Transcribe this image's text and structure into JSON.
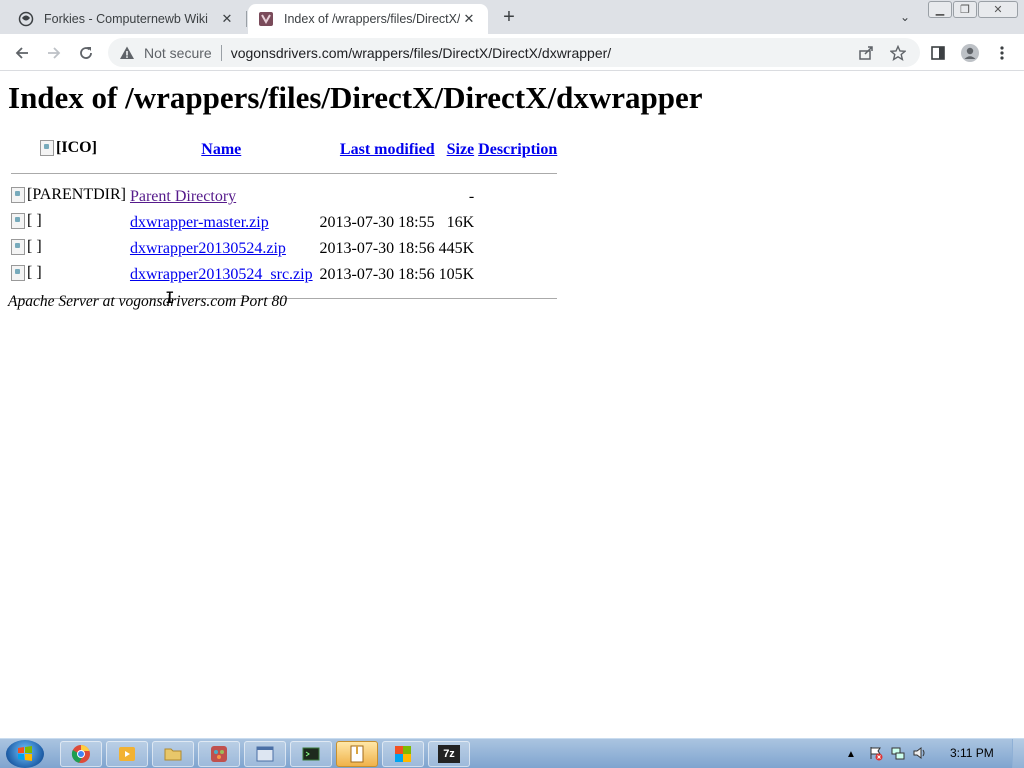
{
  "browser": {
    "tabs": [
      {
        "title": "Forkies - Computernewb Wiki",
        "icon": "wiki-icon",
        "active": false
      },
      {
        "title": "Index of /wrappers/files/DirectX/DirectX/dxwrapper",
        "icon": "vogons-icon",
        "active": true
      }
    ],
    "new_tab_symbol": "+",
    "close_symbol": "✕",
    "tab_search_symbol": "⌄",
    "window_controls": {
      "minimize": "▁",
      "restore": "❐",
      "close": "✕"
    },
    "security_label": "Not secure",
    "url": "vogonsdrivers.com/wrappers/files/DirectX/DirectX/dxwrapper/"
  },
  "page": {
    "heading": "Index of /wrappers/files/DirectX/DirectX/dxwrapper",
    "columns": {
      "icon": "[ICO]",
      "name": "Name",
      "last_modified": "Last modified",
      "size": "Size",
      "description": "Description"
    },
    "parent": {
      "icon_alt": "[PARENTDIR]",
      "name": "Parent Directory",
      "size": "-"
    },
    "rows": [
      {
        "icon_alt": "[ ]",
        "name": "dxwrapper-master.zip",
        "last_modified": "2013-07-30 18:55",
        "size": "16K"
      },
      {
        "icon_alt": "[ ]",
        "name": "dxwrapper20130524.zip",
        "last_modified": "2013-07-30 18:56",
        "size": "445K"
      },
      {
        "icon_alt": "[ ]",
        "name": "dxwrapper20130524_src.zip",
        "last_modified": "2013-07-30 18:56",
        "size": "105K"
      }
    ],
    "footer": "Apache Server at vogonsdrivers.com Port 80"
  },
  "taskbar": {
    "apps": [
      {
        "icon": "chrome-icon",
        "color": "#dd4b39"
      },
      {
        "icon": "media-player-icon",
        "color": "#f2b233"
      },
      {
        "icon": "file-explorer-icon",
        "color": "#e8c76a"
      },
      {
        "icon": "paint-icon",
        "color": "#c0504d"
      },
      {
        "icon": "window-app-icon",
        "color": "#4a6fa5"
      },
      {
        "icon": "terminal-icon",
        "color": "#3a7a3a"
      },
      {
        "icon": "archive-icon",
        "color": "#d9a441"
      },
      {
        "icon": "colorful-app-icon",
        "color": "#7bb32e"
      },
      {
        "icon": "7zip-icon",
        "color": "#222222"
      }
    ],
    "seven_zip_label": "7z",
    "clock": "3:11 PM"
  },
  "colors": {
    "link": "#0000ee",
    "visited_link": "#551a8b",
    "tabstrip": "#dee1e6",
    "taskbar": "#8fb0d6"
  }
}
